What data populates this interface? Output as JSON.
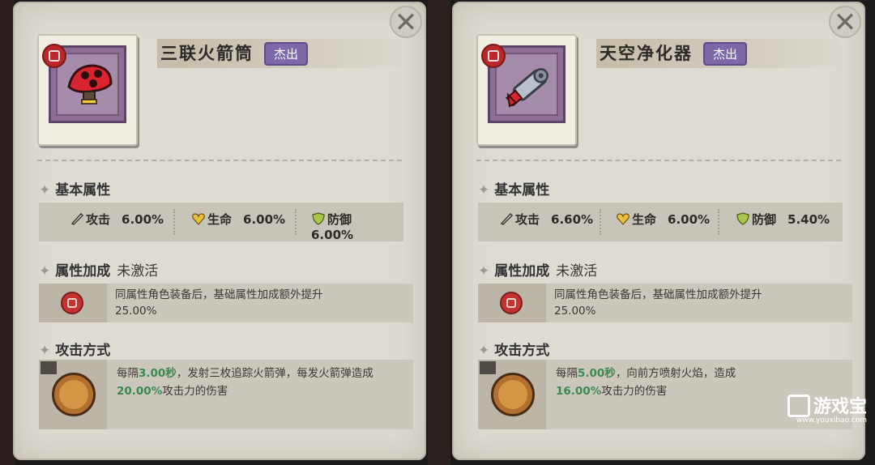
{
  "panels": [
    {
      "item_name": "三联火箭筒",
      "rarity": "杰出",
      "base_title": "基本属性",
      "stats": [
        {
          "label": "攻击",
          "value": "6.00%"
        },
        {
          "label": "生命",
          "value": "6.00%"
        },
        {
          "label": "防御",
          "value": "6.00%"
        }
      ],
      "bonus_title": "属性加成",
      "bonus_status": "未激活",
      "bonus_desc": "同属性角色装备后，基础属性加成额外提升",
      "bonus_value": "25.00%",
      "attack_title": "攻击方式",
      "attack_p1": "每隔",
      "attack_interval": "3.00秒",
      "attack_p2": "，发射三枚追踪火箭弹，每发火箭弹造成",
      "attack_dmg": "20.00%",
      "attack_p3": "攻击力的伤害"
    },
    {
      "item_name": "天空净化器",
      "rarity": "杰出",
      "base_title": "基本属性",
      "stats": [
        {
          "label": "攻击",
          "value": "6.60%"
        },
        {
          "label": "生命",
          "value": "6.00%"
        },
        {
          "label": "防御",
          "value": "5.40%"
        }
      ],
      "bonus_title": "属性加成",
      "bonus_status": "未激活",
      "bonus_desc": "同属性角色装备后，基础属性加成额外提升",
      "bonus_value": "25.00%",
      "attack_title": "攻击方式",
      "attack_p1": "每隔",
      "attack_interval": "5.00秒",
      "attack_p2": "，向前方喷射火焰，造成",
      "attack_dmg": "16.00%",
      "attack_p3": "攻击力的伤害"
    }
  ],
  "close_symbol": "✕",
  "watermark": {
    "text": "游戏宝",
    "url": "www.youxibao.com"
  },
  "colors": {
    "rarity": "#7c69a8",
    "highlight": "#3b8a52",
    "panel": "#dedbd3"
  }
}
